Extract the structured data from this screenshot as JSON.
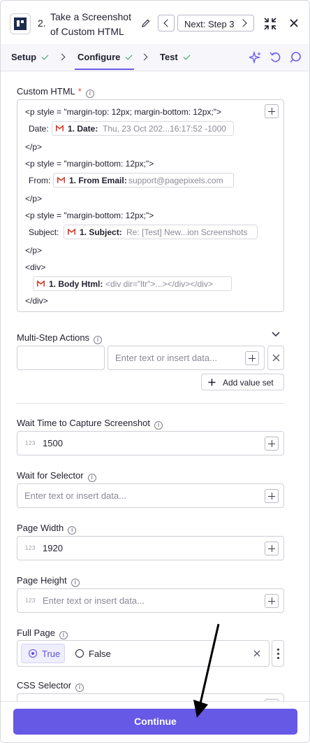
{
  "header": {
    "step_number": "2.",
    "title": "Take a Screenshot of Custom HTML",
    "next_label": "Next: Step 3"
  },
  "tabs": [
    {
      "label": "Setup"
    },
    {
      "label": "Configure"
    },
    {
      "label": "Test"
    }
  ],
  "custom_html": {
    "label": "Custom HTML",
    "required_mark": "*",
    "lines": {
      "p1_open": "<p style = \"margin-top: 12px; margin-bottom: 12px;\">",
      "date_prefix": "Date:",
      "date_pill_label": "1. Date:",
      "date_pill_value": "Thu, 23 Oct 202...16:17:52 -1000",
      "p1_close": "</p>",
      "p2_open": "<p style = \"margin-bottom: 12px;\">",
      "from_prefix": "From:",
      "from_pill_label": "1. From Email:",
      "from_pill_value": "support@pagepixels.com",
      "p2_close": "</p>",
      "p3_open": "<p style = \"margin-bottom: 12px;\">",
      "subject_prefix": "Subject:",
      "subject_pill_label": "1. Subject:",
      "subject_pill_value": "Re: [Test] New...ion Screenshots",
      "p3_close": "</p>",
      "div_open": "<div>",
      "body_pill_label": "1. Body Html:",
      "body_pill_value": "<div dir=\"ltr\">...></div></div>",
      "div_close": "</div>"
    }
  },
  "multi_step": {
    "label": "Multi-Step Actions",
    "value_placeholder": "Enter text or insert data...",
    "add_label": "Add value set"
  },
  "wait_time": {
    "label": "Wait Time to Capture Screenshot",
    "type_badge": "123",
    "value": "1500"
  },
  "wait_selector": {
    "label": "Wait for Selector",
    "placeholder": "Enter text or insert data..."
  },
  "page_width": {
    "label": "Page Width",
    "type_badge": "123",
    "value": "1920"
  },
  "page_height": {
    "label": "Page Height",
    "type_badge": "123",
    "placeholder": "Enter text or insert data..."
  },
  "full_page": {
    "label": "Full Page",
    "option_true": "True",
    "option_false": "False",
    "selected": "True"
  },
  "css_selector": {
    "label": "CSS Selector"
  },
  "footer": {
    "continue_label": "Continue"
  },
  "colors": {
    "accent": "#6659e6",
    "check": "#2f9e5d",
    "required": "#e04a3a"
  }
}
